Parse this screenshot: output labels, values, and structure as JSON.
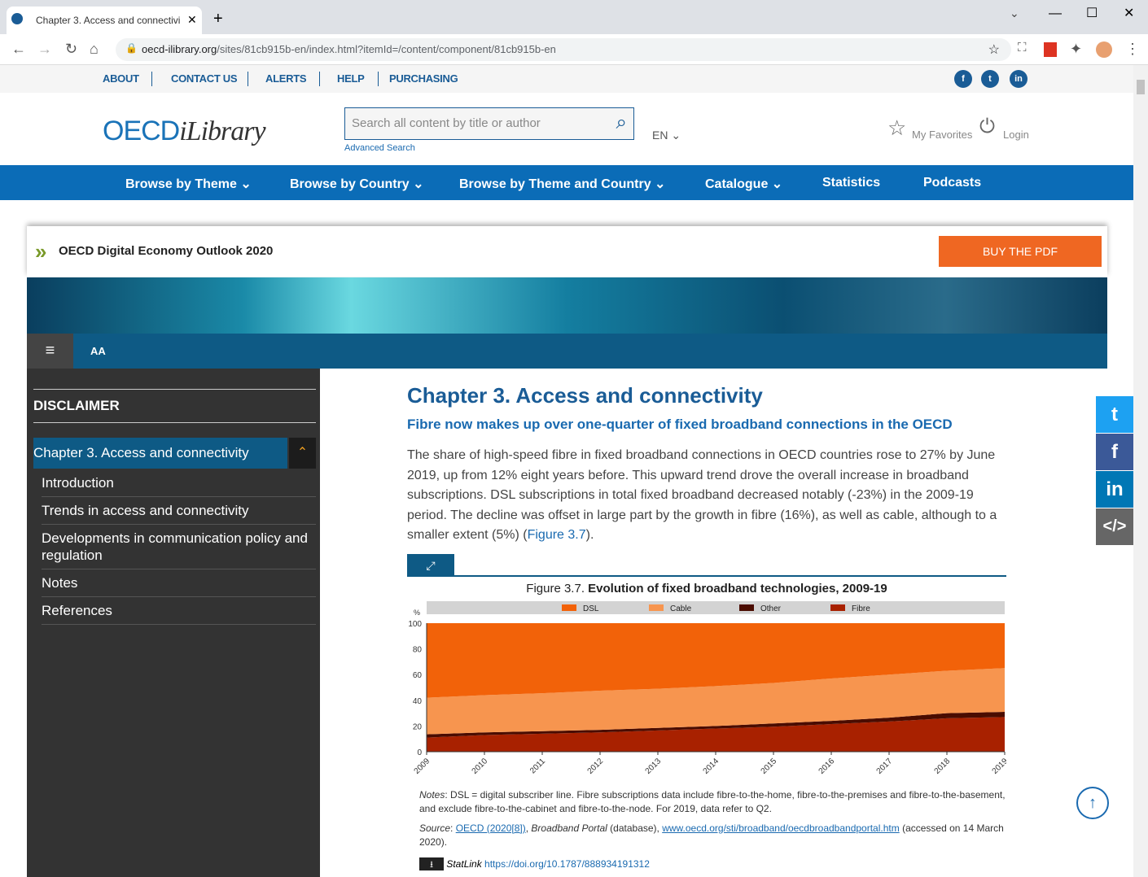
{
  "browser": {
    "tab_title": "Chapter 3. Access and connectivi",
    "url_host": "oecd-ilibrary.org",
    "url_path": "/sites/81cb915b-en/index.html?itemId=/content/component/81cb915b-en"
  },
  "toplinks": [
    "ABOUT",
    "CONTACT US",
    "ALERTS",
    "HELP",
    "PURCHASING"
  ],
  "social": [
    "f",
    "t",
    "in"
  ],
  "header": {
    "logo": "OECD",
    "logo_italic": "iLibrary",
    "search_placeholder": "Search all content by title or author",
    "advanced": "Advanced Search",
    "lang": "EN",
    "favorites": "My Favorites",
    "login": "Login"
  },
  "nav": [
    "Browse by Theme",
    "Browse by Country",
    "Browse by Theme and Country",
    "Catalogue",
    "Statistics",
    "Podcasts"
  ],
  "book": {
    "title": "OECD Digital Economy Outlook 2020",
    "buy": "BUY THE PDF",
    "font_toggle": "AA"
  },
  "sidebar": {
    "disclaimer": "DISCLAIMER",
    "chapter": "Chapter 3. Access and connectivity",
    "items": [
      "Introduction",
      "Trends in access and connectivity",
      "Developments in communication policy and regulation",
      "Notes",
      "References"
    ]
  },
  "content": {
    "title": "Chapter 3. Access and connectivity",
    "subtitle": "Fibre now makes up over one-quarter of fixed broadband connections in the OECD",
    "para": "The share of high-speed fibre in fixed broadband connections in OECD countries rose to 27% by June 2019, up from 12% eight years before. This upward trend drove the overall increase in broadband subscriptions. DSL subscriptions in total fixed broadband decreased notably (-23%) in the 2009-19 period. The decline was offset in large part by the growth in fibre (16%), as well as cable, although to a smaller extent (5%) (",
    "para_link": "Figure 3.7",
    "para_end": ").",
    "fig_label": "Figure 3.7. ",
    "fig_title": "Evolution of fixed broadband technologies, 2009-19",
    "notes_label": "Notes",
    "notes": ": DSL = digital subscriber line. Fibre subscriptions data include fibre-to-the-home, fibre-to-the-premises and fibre-to-the-basement, and exclude fibre-to-the-cabinet and fibre-to-the-node. For 2019, data refer to Q2.",
    "source_label": "Source",
    "source_link1": "OECD (2020[8])",
    "source_mid": ", ",
    "source_italic": "Broadband Portal",
    "source_mid2": " (database), ",
    "source_link2": "www.oecd.org/sti/broadband/oecdbroadbandportal.htm",
    "source_end": " (accessed on 14 March 2020).",
    "statlink_label": "StatLink",
    "statlink": "https://doi.org/10.1787/888934191312"
  },
  "chart_data": {
    "type": "area",
    "title": "Evolution of fixed broadband technologies, 2009-19",
    "ylabel": "%",
    "ylim": [
      0,
      100
    ],
    "yticks": [
      0,
      20,
      40,
      60,
      80,
      100
    ],
    "stacked": true,
    "legend": "top",
    "x": [
      "2009",
      "2010",
      "2011",
      "2012",
      "2013",
      "2014",
      "2015",
      "2016",
      "2017",
      "2018",
      "2019"
    ],
    "series": [
      {
        "name": "Fibre",
        "color": "#a82100",
        "values": [
          11,
          13,
          14,
          15,
          16.5,
          18,
          19.5,
          21.5,
          23.5,
          26,
          27
        ]
      },
      {
        "name": "Other",
        "color": "#4a0c00",
        "values": [
          2.5,
          2,
          2,
          2,
          2,
          2,
          2.5,
          2.5,
          3,
          4,
          4
        ]
      },
      {
        "name": "Cable",
        "color": "#f7954f",
        "values": [
          28.5,
          29,
          29.5,
          30.5,
          30.5,
          31,
          31.5,
          33,
          33.5,
          33,
          34
        ]
      },
      {
        "name": "DSL",
        "color": "#f26209",
        "values": [
          58,
          56,
          54.5,
          52.5,
          51,
          49,
          46.5,
          43,
          40,
          37,
          35
        ]
      }
    ]
  }
}
